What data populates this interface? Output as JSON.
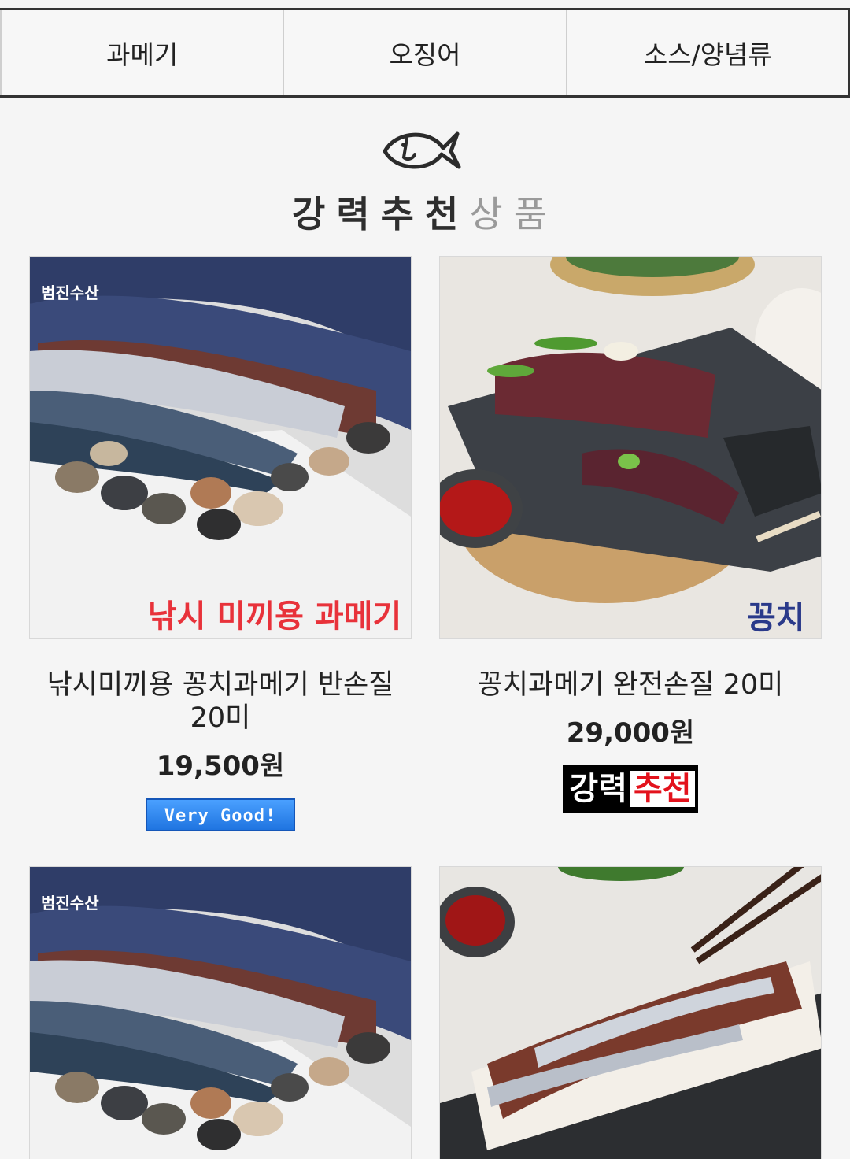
{
  "tabs": [
    "과메기",
    "오징어",
    "소스/양념류"
  ],
  "section": {
    "title_dark": "강력추천",
    "title_light": "상품"
  },
  "products": [
    {
      "name": "낚시미끼용 꽁치과메기 반손질 20미",
      "price": "19,500원",
      "overlay": "낚시 미끼용 과메기",
      "brand": "범진수산",
      "badge": "Very Good!"
    },
    {
      "name": "꽁치과메기 완전손질 20미",
      "price": "29,000원",
      "overlay": "꽁치",
      "badge_white": "강력",
      "badge_red": "추천"
    },
    {
      "brand": "범진수산"
    },
    {}
  ]
}
